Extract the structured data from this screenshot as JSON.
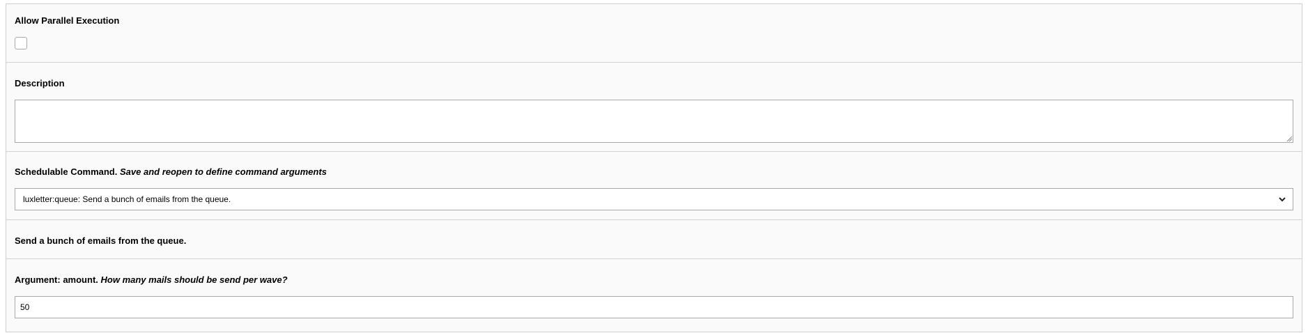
{
  "form": {
    "parallel": {
      "label": "Allow Parallel Execution",
      "checked": false
    },
    "description": {
      "label": "Description",
      "value": ""
    },
    "command": {
      "label": "Schedulable Command.",
      "hint": "Save and reopen to define command arguments",
      "selected": "luxletter:queue: Send a bunch of emails from the queue."
    },
    "command_info": {
      "text": "Send a bunch of emails from the queue."
    },
    "argument": {
      "label": "Argument: amount.",
      "hint": "How many mails should be send per wave?",
      "value": "50"
    }
  }
}
